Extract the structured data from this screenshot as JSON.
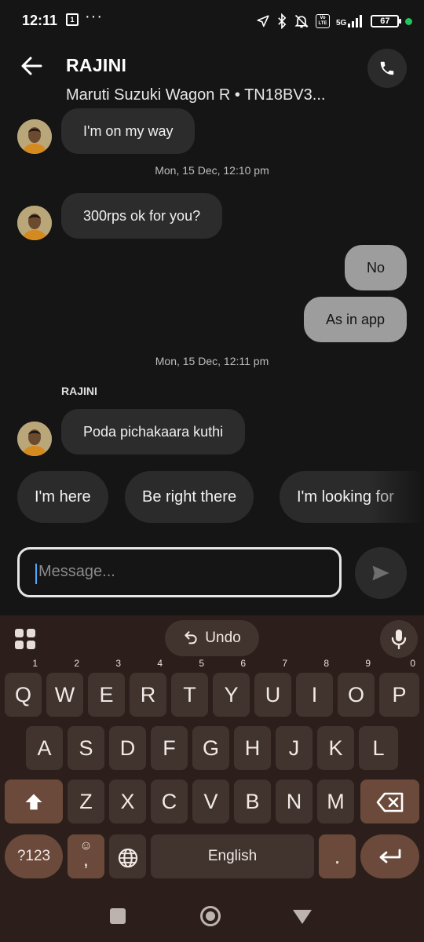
{
  "status_bar": {
    "time": "12:11",
    "calendar_day": "1",
    "overflow": "···",
    "network": "5G",
    "volte": "Vo LTE",
    "battery": "67"
  },
  "header": {
    "contact_name": "RAJINI",
    "vehicle": "Maruti Suzuki Wagon R • TN18BV3..."
  },
  "messages": [
    {
      "direction": "in",
      "text": "I'm on my way"
    },
    {
      "timestamp": "Mon, 15 Dec, 12:10 pm"
    },
    {
      "direction": "in",
      "text": "300rps ok for you?"
    },
    {
      "direction": "out",
      "text": "No"
    },
    {
      "direction": "out",
      "text": "As in app"
    },
    {
      "timestamp": "Mon, 15 Dec, 12:11 pm"
    },
    {
      "sender": "RAJINI"
    },
    {
      "direction": "in",
      "text": "Poda pichakaara kuthi"
    }
  ],
  "quick_replies": [
    "I'm here",
    "Be right there",
    "I'm looking for"
  ],
  "composer": {
    "placeholder": "Message..."
  },
  "keyboard": {
    "undo_label": "Undo",
    "row1": [
      {
        "key": "Q",
        "hint": "1"
      },
      {
        "key": "W",
        "hint": "2"
      },
      {
        "key": "E",
        "hint": "3"
      },
      {
        "key": "R",
        "hint": "4"
      },
      {
        "key": "T",
        "hint": "5"
      },
      {
        "key": "Y",
        "hint": "6"
      },
      {
        "key": "U",
        "hint": "7"
      },
      {
        "key": "I",
        "hint": "8"
      },
      {
        "key": "O",
        "hint": "9"
      },
      {
        "key": "P",
        "hint": "0"
      }
    ],
    "row2": [
      "A",
      "S",
      "D",
      "F",
      "G",
      "H",
      "J",
      "K",
      "L"
    ],
    "row3": [
      "Z",
      "X",
      "C",
      "V",
      "B",
      "N",
      "M"
    ],
    "symbols_label": "?123",
    "emoji_comma": ",",
    "space_label": "English",
    "period_label": "."
  },
  "colors": {
    "background": "#151515",
    "incoming_bubble": "#2c2c2c",
    "outgoing_bubble": "#9d9d9d",
    "keyboard_bg": "#2c1f1b",
    "key_bg": "#41332e",
    "key_accent": "#6b4a3c",
    "status_dot": "#22c55e"
  }
}
